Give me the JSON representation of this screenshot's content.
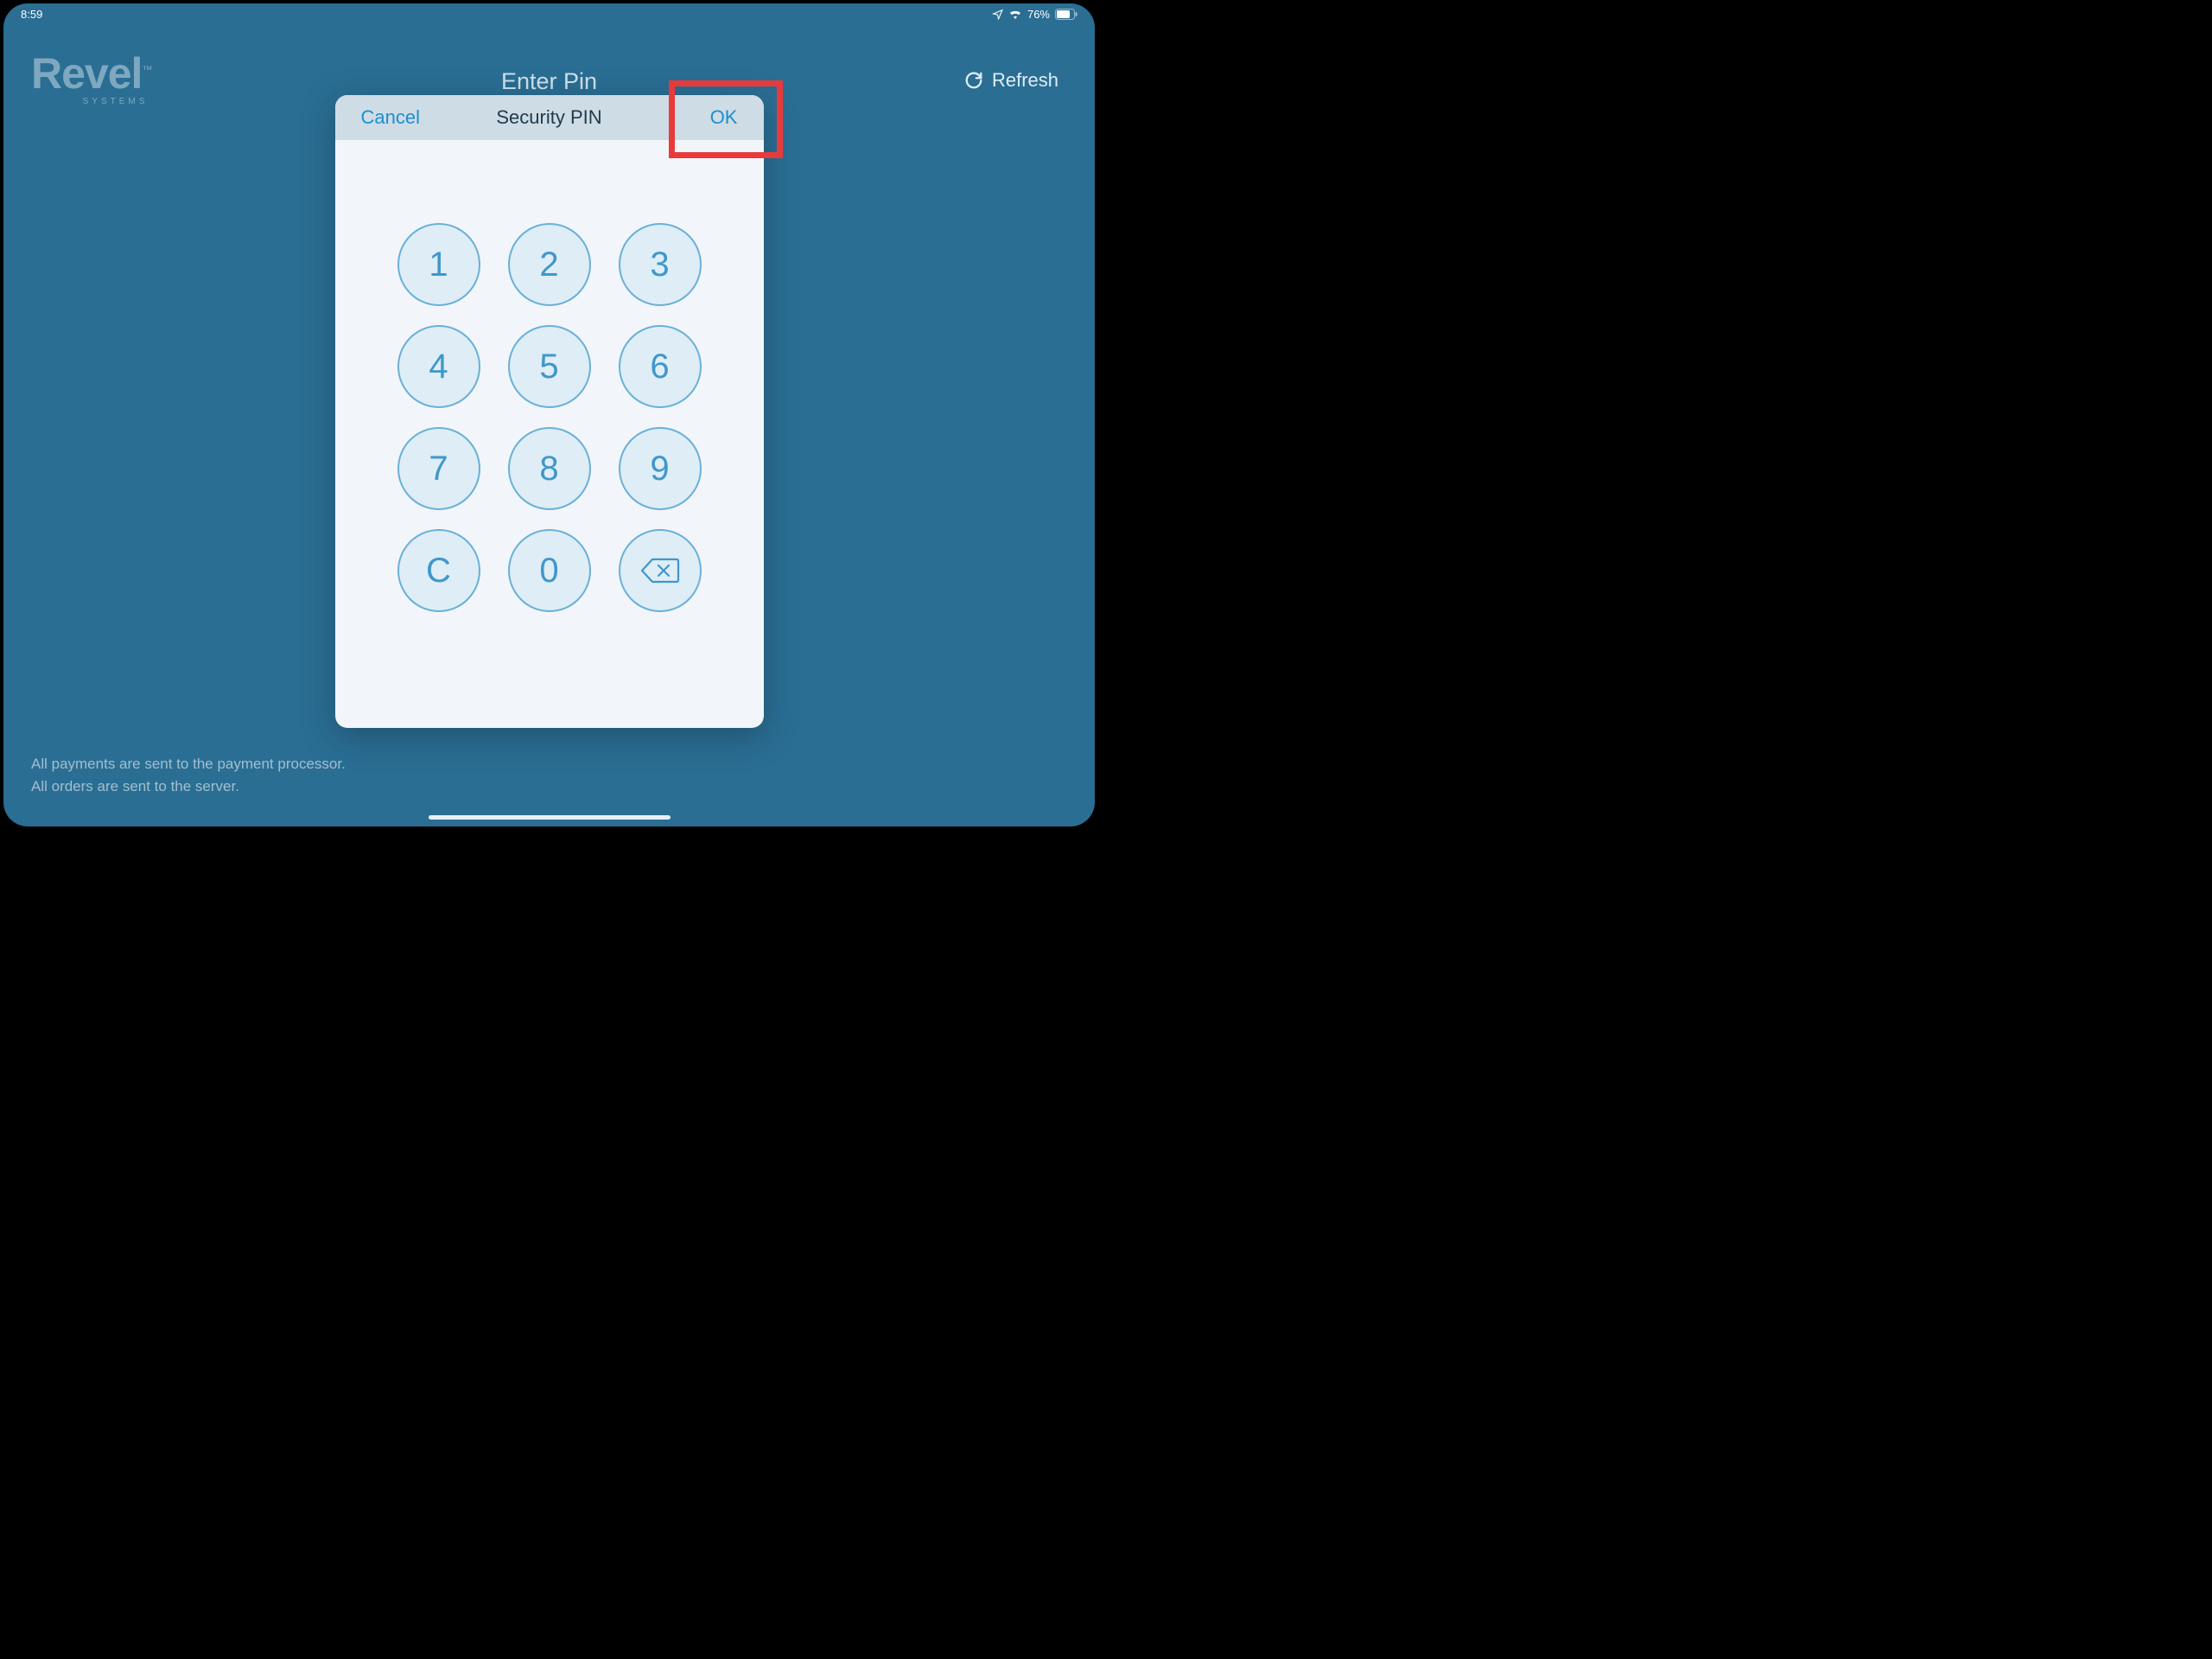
{
  "status": {
    "time": "8:59",
    "battery": "76%"
  },
  "logo": {
    "main": "Revel",
    "sub": "SYSTEMS",
    "tm": "™"
  },
  "page_title": "Enter Pin",
  "refresh_label": "Refresh",
  "modal": {
    "cancel": "Cancel",
    "title": "Security PIN",
    "ok": "OK"
  },
  "keypad": {
    "k1": "1",
    "k2": "2",
    "k3": "3",
    "k4": "4",
    "k5": "5",
    "k6": "6",
    "k7": "7",
    "k8": "8",
    "k9": "9",
    "kc": "C",
    "k0": "0"
  },
  "footer": {
    "line1": "All payments are sent to the payment processor.",
    "line2": "All orders are sent to the server."
  }
}
